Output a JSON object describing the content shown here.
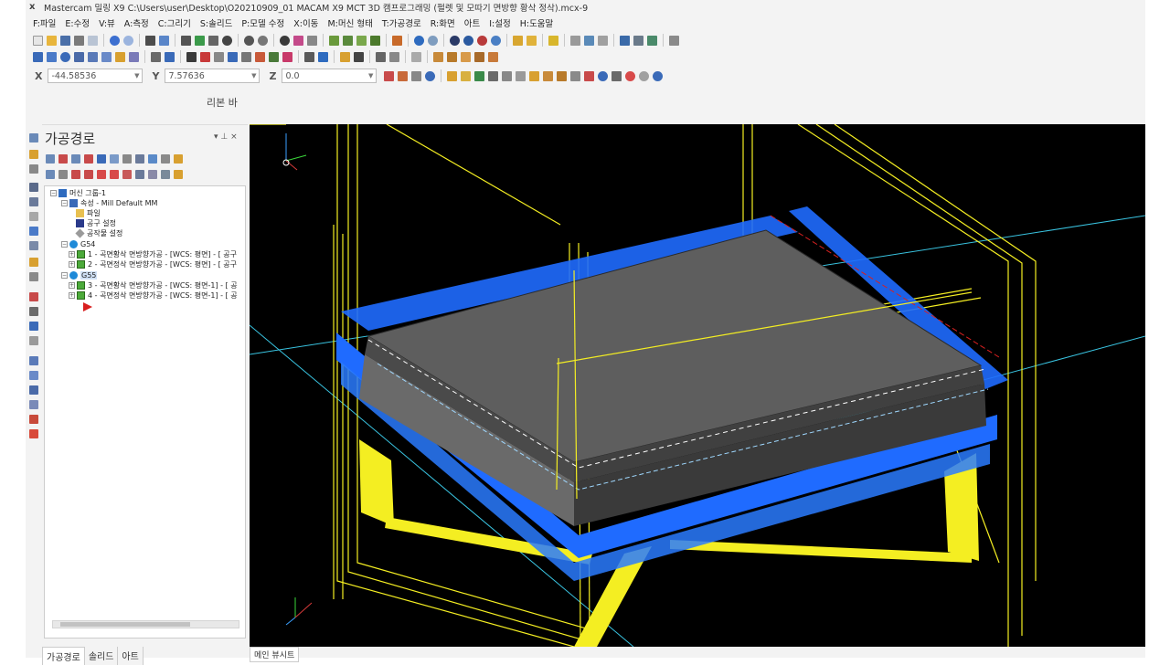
{
  "window": {
    "title": "Mastercam 밀링 X9  C:\\Users\\user\\Desktop\\O20210909_01 MACAM X9 MCT 3D 캠프로그래밍 (펄렛 및 모따기 면방향 황삭 정삭).mcx-9"
  },
  "menu": [
    "F:파일",
    "E:수정",
    "V:뷰",
    "A:측정",
    "C:그리기",
    "S:솔리드",
    "P:모델 수정",
    "X:이동",
    "M:머신 형태",
    "T:가공경로",
    "R:화면",
    "아트",
    "I:설정",
    "H:도움말"
  ],
  "coords": {
    "x_label": "X",
    "x_value": "-44.58536",
    "y_label": "Y",
    "y_value": "7.57636",
    "z_label": "Z",
    "z_value": "0.0"
  },
  "ribbon_label": "리본 바",
  "panel": {
    "title": "가공경로",
    "pin": "▾ ⊥ ×"
  },
  "tree": {
    "machine_group": "머신 그룹-1",
    "properties": "속성 - Mill Default MM",
    "files": "파일",
    "tool_settings": "공구 설정",
    "stock_setup": "공작물 설정",
    "group_g54": "G54",
    "op1": "1 - 곡면황삭 면방향가공 - [WCS: 평면] - [ 공구",
    "op2": "2 - 곡면정삭 면방향가공 - [WCS: 평면] - [ 공구",
    "group_g55": "G55",
    "op3": "3 - 곡면황삭 면방향가공 - [WCS: 평면-1] - [ 공",
    "op4": "4 - 곡면정삭 면방향가공 - [WCS: 평면-1] - [ 공"
  },
  "bottom_tabs": [
    "가공경로",
    "솔리드",
    "아트"
  ],
  "viewport_tab": "메인 뷰시트",
  "colors": {
    "wire_yellow": "#f4ee22",
    "toolpath_blue": "#1f6bff",
    "model_gray": "#5e5e5e",
    "axis_cyan": "#39c3e0",
    "background": "#000000"
  }
}
